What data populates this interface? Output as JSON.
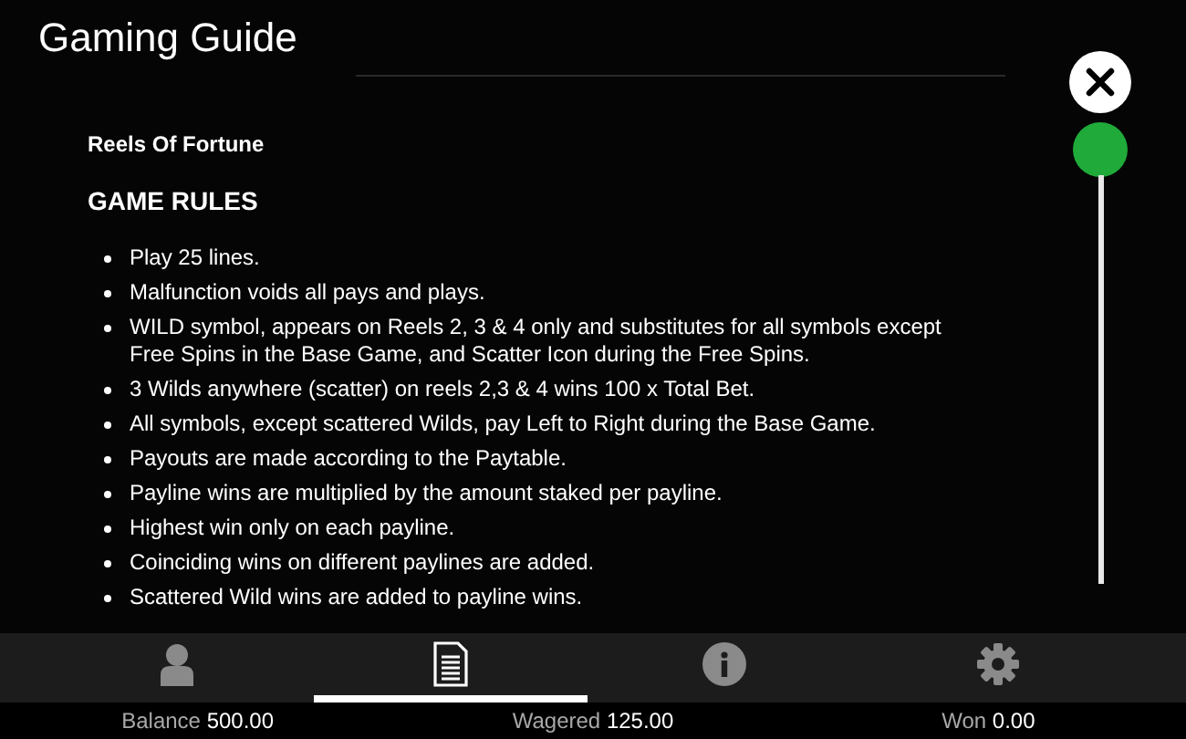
{
  "window": {
    "title": "Gaming Guide"
  },
  "game_name": "Reels Of Fortune",
  "section_heading": "GAME RULES",
  "rules": [
    "Play 25 lines.",
    "Malfunction voids all pays and plays.",
    "WILD symbol, appears on Reels 2, 3 & 4 only and substitutes for all symbols except Free Spins in the Base Game, and Scatter Icon during the Free Spins.",
    "3 Wilds anywhere (scatter) on reels 2,3 & 4 wins 100 x Total Bet.",
    "All symbols, except scattered Wilds, pay Left to Right during the Base Game.",
    "Payouts are made according to the Paytable.",
    "Payline wins are multiplied by the amount staked per payline.",
    "Highest win only on each payline.",
    "Coinciding wins on different paylines are added.",
    "Scattered Wild wins are added to payline wins."
  ],
  "nav_tabs": [
    {
      "kind": "account",
      "selected": false
    },
    {
      "kind": "guide",
      "selected": true
    },
    {
      "kind": "info",
      "selected": false
    },
    {
      "kind": "settings",
      "selected": false
    }
  ],
  "status_bar": [
    {
      "label": "Balance",
      "value": "500.00"
    },
    {
      "label": "Wagered",
      "value": "125.00"
    },
    {
      "label": "Won",
      "value": "0.00"
    }
  ]
}
